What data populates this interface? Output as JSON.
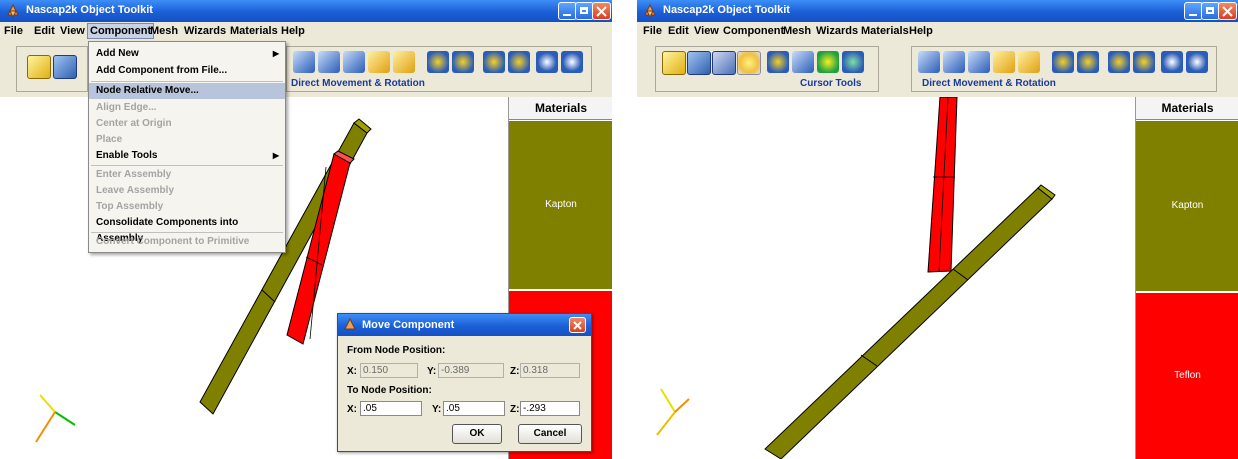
{
  "app_title": "Nascap2k Object Toolkit",
  "menu": [
    "File",
    "Edit",
    "View",
    "Component",
    "Mesh",
    "Wizards",
    "Materials",
    "Help"
  ],
  "toolbar_labels": {
    "direct_movement": "Direct Movement & Rotation",
    "cursor_tools": "Cursor Tools"
  },
  "component_menu": {
    "items": [
      {
        "label": "Add New",
        "enabled": true,
        "submenu": true
      },
      {
        "label": "Add Component from File...",
        "enabled": true
      },
      {
        "label": "Node Relative Move...",
        "enabled": true,
        "highlighted": true
      },
      {
        "label": "Align Edge...",
        "enabled": false
      },
      {
        "label": "Center at Origin",
        "enabled": false
      },
      {
        "label": "Place",
        "enabled": false
      },
      {
        "label": "Enable Tools",
        "enabled": true,
        "submenu": true
      },
      {
        "label": "Enter Assembly",
        "enabled": false
      },
      {
        "label": "Leave Assembly",
        "enabled": false
      },
      {
        "label": "Top Assembly",
        "enabled": false
      },
      {
        "label": "Consolidate Components into Assembly",
        "enabled": true
      },
      {
        "label": "Convert Component to Primitive",
        "enabled": false
      }
    ]
  },
  "materials_panel": {
    "title": "Materials",
    "items": [
      {
        "name": "Kapton",
        "color": "#808000"
      },
      {
        "name": "Teflon",
        "color": "#ff0000"
      }
    ]
  },
  "move_dialog": {
    "title": "Move Component",
    "from_label": "From Node Position:",
    "to_label": "To Node Position:",
    "from": {
      "x_label": "X:",
      "x": "0.150",
      "y_label": "Y:",
      "y": "-0.389",
      "z_label": "Z:",
      "z": "0.318"
    },
    "to": {
      "x_label": "X:",
      "x": ".05",
      "y_label": "Y:",
      "y": ".05",
      "z_label": "Z:",
      "z": "-.293"
    },
    "ok": "OK",
    "cancel": "Cancel"
  },
  "colors": {
    "titlebar": "#1b5fd6",
    "kapton": "#808000",
    "teflon": "#ff0000"
  }
}
